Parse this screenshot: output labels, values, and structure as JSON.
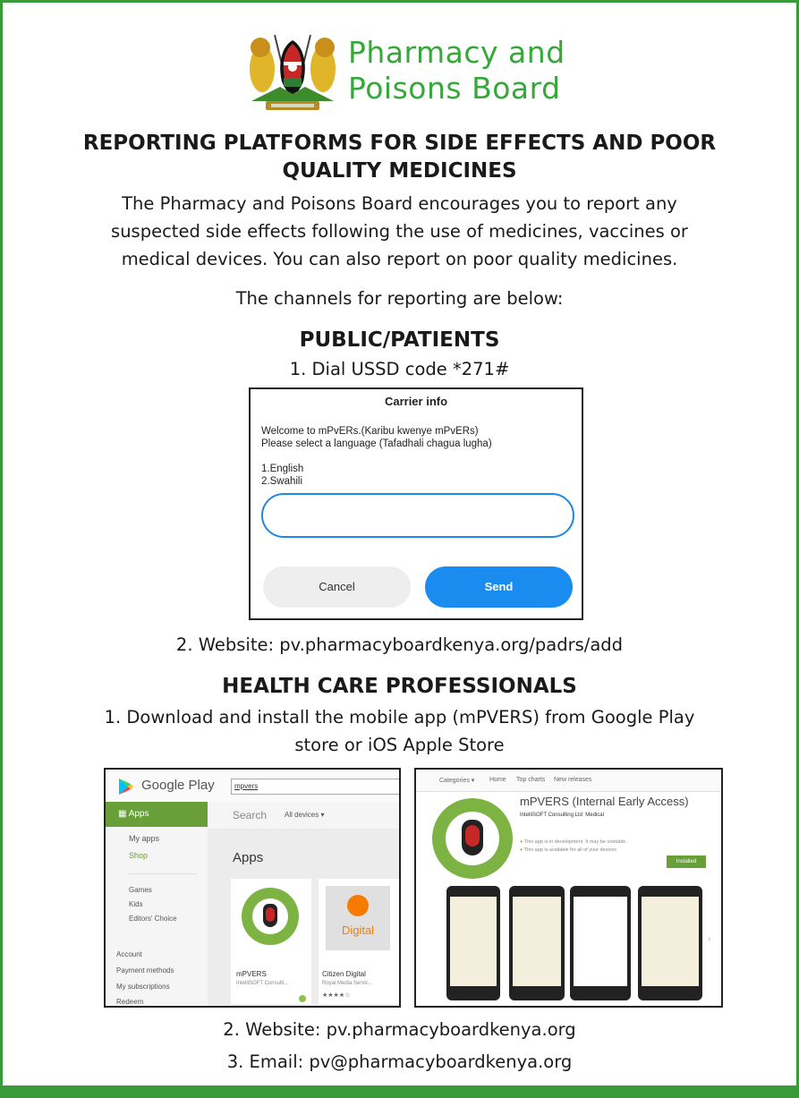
{
  "brand": {
    "line1": "Pharmacy and",
    "line2": "Poisons Board"
  },
  "title_line1": "REPORTING PLATFORMS FOR SIDE EFFECTS AND POOR",
  "title_line2": "QUALITY MEDICINES",
  "intro": [
    "The Pharmacy and Poisons Board encourages you to report any",
    "suspected side effects following the use of medicines, vaccines or",
    "medical devices. You can also report on poor quality medicines."
  ],
  "channels_text": "The channels for reporting are below:",
  "public": {
    "heading": "PUBLIC/PATIENTS",
    "step1": "1. Dial USSD code *271#",
    "ussd": {
      "title": "Carrier info",
      "message": "Welcome to mPvERs.(Karibu kwenye mPvERs)\nPlease select a language (Tafadhali chagua lugha)\n\n1.English\n2.Swahili",
      "input_value": "",
      "cancel_label": "Cancel",
      "send_label": "Send"
    },
    "step2": "2. Website: pv.pharmacyboardkenya.org/padrs/add"
  },
  "professionals": {
    "heading": "HEALTH CARE PROFESSIONALS",
    "step1_line1": "1. Download and install the mobile app (mPVERS) from Google Play",
    "step1_line2": "store or iOS Apple Store",
    "google_play": {
      "brand": "Google Play",
      "search_value": "mpvers",
      "apps_label": "Apps",
      "search_tab": "Search",
      "devices_label": "All devices",
      "my_apps": "My apps",
      "shop": "Shop",
      "games": "Games",
      "kids": "Kids",
      "editors_choice": "Editors' Choice",
      "account": "Account",
      "payment_methods": "Payment methods",
      "my_subscriptions": "My subscriptions",
      "redeem": "Redeem",
      "section_title": "Apps",
      "app1_name": "mPVERS",
      "app1_dev": "IntelliSOFT Consulti...",
      "app2_name": "Citizen Digital",
      "app2_dev": "Royal Media Servic...",
      "app2_logo_text": "Digital"
    },
    "app_store": {
      "nav": [
        "Categories",
        "Home",
        "Top charts",
        "New releases"
      ],
      "app_title": "mPVERS (Internal Early Access)",
      "developer": "IntelliSOFT Consulting Ltd",
      "category": "Medical",
      "note1": "This app is in development. It may be unstable.",
      "note2": "This app is available for all of your devices",
      "install_label": "Installed"
    },
    "step2": "2. Website: pv.pharmacyboardkenya.org",
    "step3": "3. Email: pv@pharmacyboardkenya.org"
  },
  "colors": {
    "brand_green": "#36a83a",
    "border_green": "#3a9a3a",
    "send_blue": "#1a8cf0",
    "play_green": "#689f38"
  }
}
